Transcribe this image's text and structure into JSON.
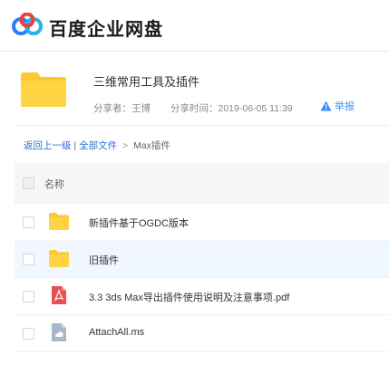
{
  "header": {
    "brand": "百度企业网盘"
  },
  "share": {
    "title": "三维常用工具及插件",
    "sharer_label": "分享者：",
    "sharer": "王博",
    "time_label": "分享时间：",
    "time": "2019-06-05 11:39",
    "report_label": "举报"
  },
  "breadcrumb": {
    "back": "返回上一级",
    "divider": "|",
    "all_files": "全部文件",
    "sep": ">",
    "current": "Max插件"
  },
  "list": {
    "header": {
      "name_col": "名称"
    },
    "rows": [
      {
        "name": "新插件基于OGDC版本",
        "icon": "folder-icon"
      },
      {
        "name": "旧插件",
        "icon": "folder-icon",
        "highlighted": true
      },
      {
        "name": "3.3 3ds Max导出插件使用说明及注意事项.pdf",
        "icon": "pdf-icon"
      },
      {
        "name": "AttachAll.ms",
        "icon": "generic-file-icon"
      }
    ]
  },
  "colors": {
    "accent": "#3b8cff",
    "link": "#2a6fd6",
    "folder": "#ffc731",
    "pdf": "#e94f4f",
    "row_highlight": "#f1f7ff"
  }
}
